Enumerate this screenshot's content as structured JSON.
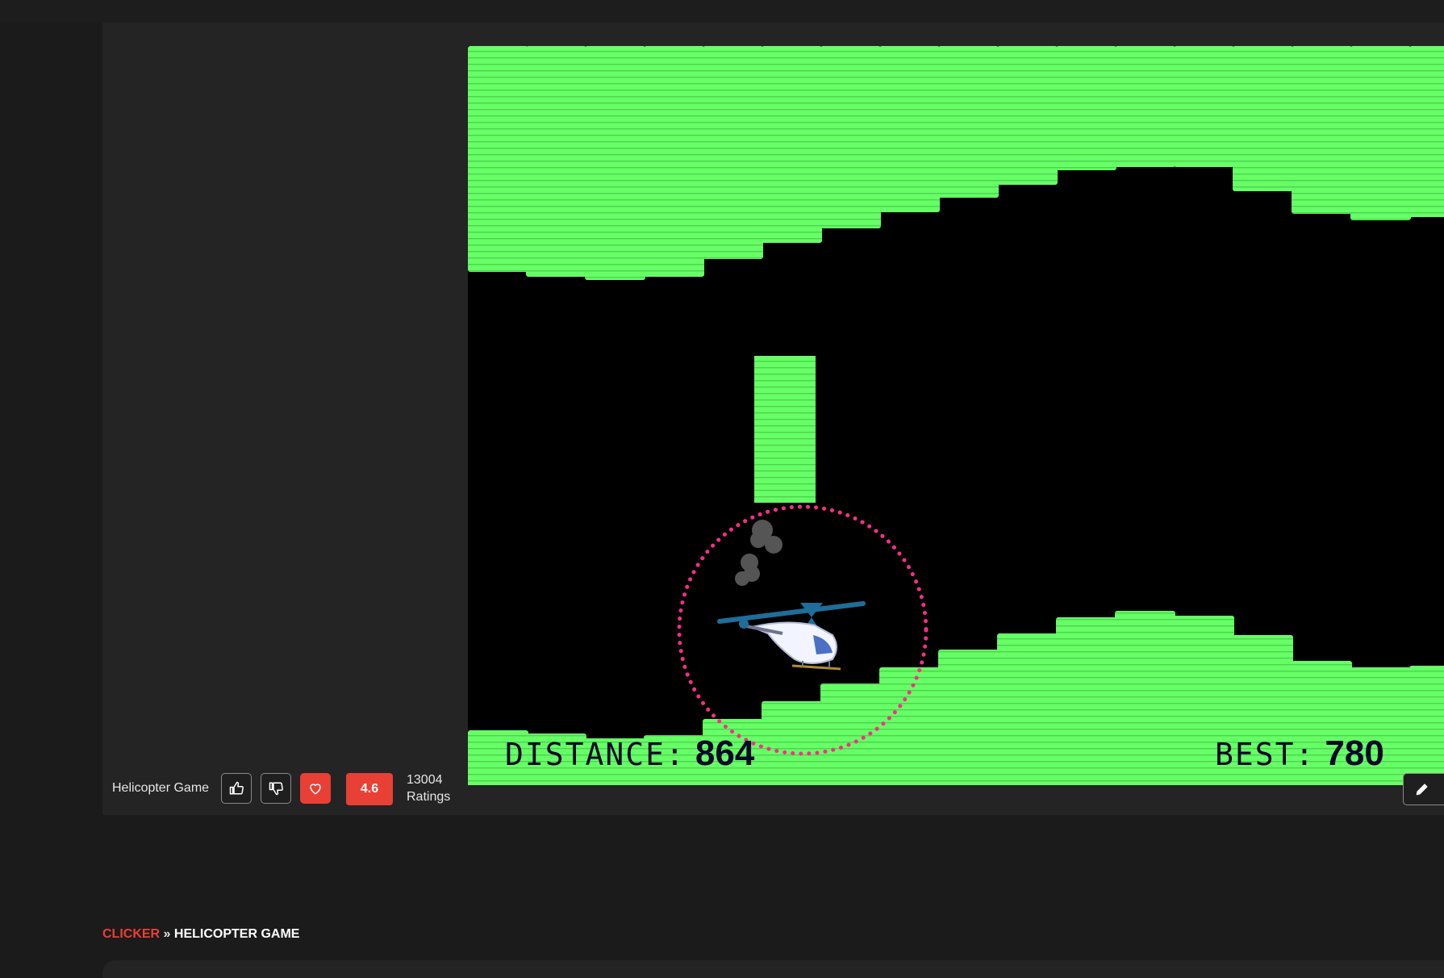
{
  "game": {
    "title": "Helicopter Game",
    "distance_label": "DISTANCE:",
    "distance_value": "864",
    "best_label": "BEST:",
    "best_value": "780",
    "colors": {
      "terrain": "#66ff66",
      "background": "#000000",
      "target_ring": "#ff2d8a",
      "hud_text": "#05082a"
    }
  },
  "toolbar": {
    "title": "Helicopter Game",
    "like_icon": "thumbs-up-icon",
    "dislike_icon": "thumbs-down-icon",
    "favorite_icon": "heart-icon",
    "rating": "4.6",
    "rating_count": "13004",
    "rating_count_label": "Ratings",
    "edit_icon": "pencil-icon"
  },
  "breadcrumb": {
    "root": "CLICKER",
    "separator": " » ",
    "current": "HELICOPTER GAME"
  },
  "colors": {
    "accent": "#e84034",
    "page_background": "#1b1b1b",
    "panel_background": "#242424"
  }
}
